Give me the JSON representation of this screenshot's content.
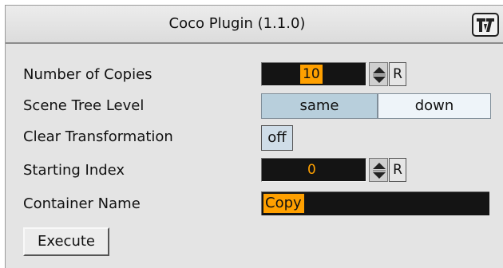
{
  "header": {
    "title": "Coco Plugin (1.1.0)",
    "logo_icon": "vizrt-logo-icon"
  },
  "fields": {
    "copies": {
      "label": "Number of Copies",
      "value": "10",
      "reset_label": "R"
    },
    "scene_tree": {
      "label": "Scene Tree Level",
      "options": [
        "same",
        "down"
      ],
      "selected": "same"
    },
    "clear_transform": {
      "label": "Clear Transformation",
      "value": "off"
    },
    "starting_index": {
      "label": "Starting Index",
      "value": "0",
      "reset_label": "R"
    },
    "container_name": {
      "label": "Container Name",
      "value": "Copy"
    }
  },
  "actions": {
    "execute_label": "Execute"
  },
  "colors": {
    "panel_bg": "#e4e4e4",
    "field_bg": "#141414",
    "value_highlight": "#ffa000",
    "segment_active": "#b8cfdc",
    "segment_inactive": "#eef4f9"
  }
}
